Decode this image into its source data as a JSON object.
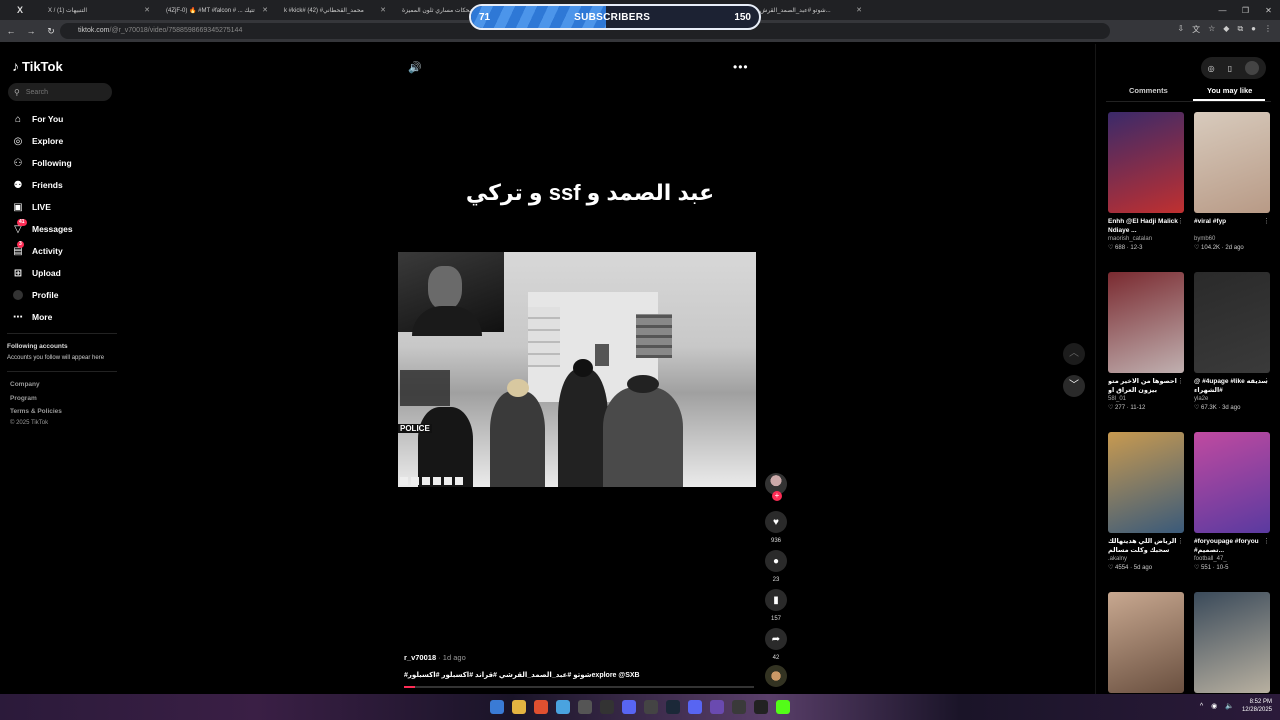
{
  "browser": {
    "tabs": [
      {
        "label": "X"
      },
      {
        "label": "X / (1) التنبيهات"
      },
      {
        "label": "(4ZjF-0) 🔥 #MT #falcon # ... تتيك"
      },
      {
        "label": "k #kick# محمد_القحطاني# (42)"
      },
      {
        "label": "مضحكات مساري ثلون المميزة#"
      },
      {
        "label": "شوتو #عبد_الصمد_القرش..."
      }
    ],
    "url_host": "tiktok.com",
    "url_path": "/@r_v70018/video/7588598669345275144"
  },
  "overlay": {
    "left_value": "71",
    "label": "SUBSCRIBERS",
    "right_value": "150",
    "progress": 0.47
  },
  "sidebar": {
    "logo": "TikTok",
    "search_placeholder": "Search",
    "items": [
      {
        "label": "For You",
        "icon": "home-icon"
      },
      {
        "label": "Explore",
        "icon": "compass-icon"
      },
      {
        "label": "Following",
        "icon": "following-icon"
      },
      {
        "label": "Friends",
        "icon": "friends-icon"
      },
      {
        "label": "LIVE",
        "icon": "live-icon"
      },
      {
        "label": "Messages",
        "icon": "messages-icon",
        "badge": "41"
      },
      {
        "label": "Activity",
        "icon": "activity-icon",
        "badge": "3"
      },
      {
        "label": "Upload",
        "icon": "upload-icon"
      },
      {
        "label": "Profile",
        "icon": "profile-icon"
      },
      {
        "label": "More",
        "icon": "more-icon"
      }
    ],
    "following_heading": "Following accounts",
    "following_note": "Accounts you follow will appear here",
    "footer": [
      "Company",
      "Program",
      "Terms & Policies"
    ],
    "copyright": "© 2025 TikTok"
  },
  "video": {
    "title": "عبد الصمد و ssf و تركي",
    "overlay_police": "POLICE",
    "author": "r_v70018",
    "time": "· 1d ago",
    "caption": "#شوتو #عبد_الصمد_القرشي #قراند #اكسبلور #اكسبلورexplore @SXB",
    "progress": 0.03
  },
  "actions": {
    "likes": "936",
    "comments": "23",
    "saves": "157",
    "shares": "42"
  },
  "right_panel": {
    "tabs": [
      "Comments",
      "You may like"
    ],
    "active_tab": "You may like",
    "cards": [
      {
        "caption": "Enhh @El Hadji Malick Ndiaye ...",
        "user": "maorish_catalan",
        "likes": "688",
        "date": "12-3",
        "colors": [
          "#3a2a6a",
          "#c03030"
        ]
      },
      {
        "caption": "#viral #fyp",
        "user": "bymb60",
        "likes": "104.2K",
        "date": "2d ago",
        "colors": [
          "#d8cbbd",
          "#b89a86"
        ]
      },
      {
        "caption": "احصوها من الاخير متو بيزون العراق او الامارات؟",
        "user": "58l_01",
        "likes": "277",
        "date": "11-12",
        "colors": [
          "#7a2a30",
          "#c0b0b0"
        ]
      },
      {
        "caption": "@ #4upage #like سديقه الشهراء#",
        "user": "yla2e",
        "likes": "67.3K",
        "date": "3d ago",
        "colors": [
          "#2a2a2a",
          "#3a3a3a"
        ]
      },
      {
        "caption": "الرياض اللي هديتهالك سحبك وكلت مسالم",
        "user": ".akalny",
        "likes": "4554",
        "date": "5d ago",
        "colors": [
          "#c89a50",
          "#3a5a7a"
        ]
      },
      {
        "caption": "#foryoupage #foryou #تصميم...",
        "user": "football_47_",
        "likes": "551",
        "date": "10-5",
        "colors": [
          "#c04aa0",
          "#5a3aa0"
        ]
      },
      {
        "caption": "",
        "user": "",
        "likes": "",
        "date": "",
        "colors": [
          "#c8a890",
          "#6a5040"
        ]
      },
      {
        "caption": "",
        "user": "",
        "likes": "",
        "date": "",
        "colors": [
          "#3a4a5a",
          "#b8b0a0"
        ]
      }
    ]
  },
  "taskbar": {
    "time": "8:52 PM",
    "date": "12/28/2025"
  }
}
